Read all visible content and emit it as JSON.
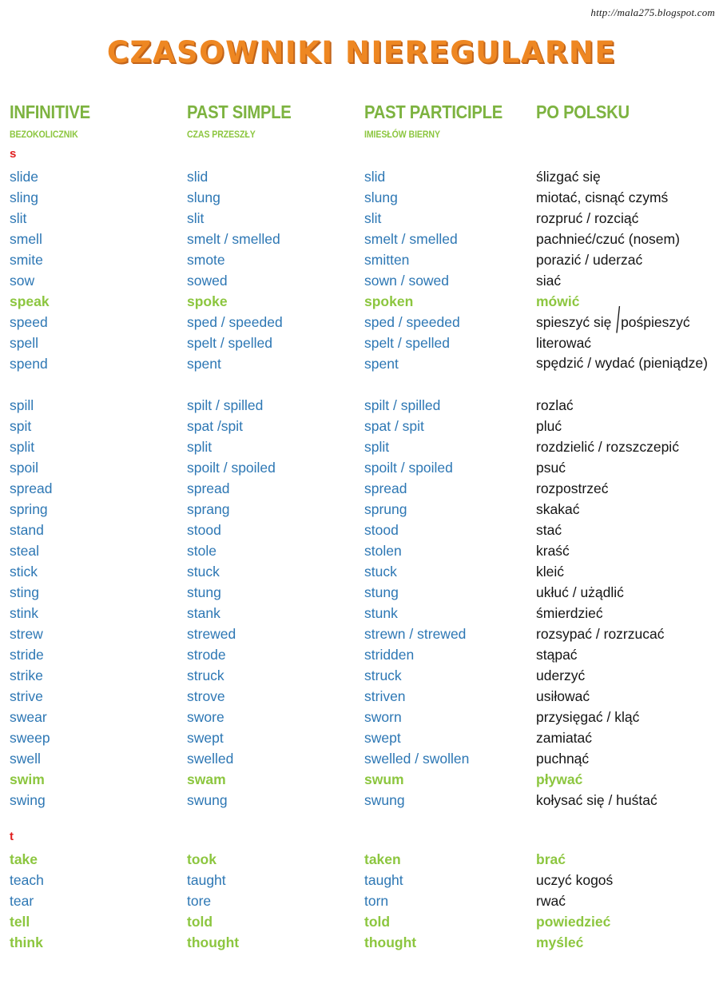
{
  "site_url": "http://mala275.blogspot.com",
  "title": "CZASOWNIKI NIEREGULARNE",
  "colors": {
    "title_orange": "#ee8722",
    "header_green": "#7db340",
    "verb_blue": "#2d77b4",
    "verb_green": "#8cc63f",
    "polish_black": "#141414",
    "section_red": "#e02020"
  },
  "headers": [
    {
      "main": "INFINITIVE",
      "sub": "BEZOKOLICZNIK"
    },
    {
      "main": "PAST SIMPLE",
      "sub": "CZAS PRZESZŁY"
    },
    {
      "main": "PAST PARTICIPLE",
      "sub": "IMIESŁÓW BIERNY"
    },
    {
      "main": "PO POLSKU",
      "sub": ""
    }
  ],
  "sections": [
    {
      "letter": "s",
      "rows": [
        {
          "infinitive": "slide",
          "past": "slid",
          "participle": "slid",
          "polish": "ślizgać się",
          "hl": false
        },
        {
          "infinitive": "sling",
          "past": "slung",
          "participle": "slung",
          "polish": "miotać, cisnąć czymś",
          "hl": false
        },
        {
          "infinitive": "slit",
          "past": "slit",
          "participle": "slit",
          "polish": "rozpruć / rozciąć",
          "hl": false
        },
        {
          "infinitive": "smell",
          "past": "smelt / smelled",
          "participle": "smelt / smelled",
          "polish": "pachnieć/czuć (nosem)",
          "hl": false
        },
        {
          "infinitive": "smite",
          "past": "smote",
          "participle": "smitten",
          "polish": "porazić / uderzać",
          "hl": false
        },
        {
          "infinitive": "sow",
          "past": "sowed",
          "participle": "sown / sowed",
          "polish": "siać",
          "hl": false
        },
        {
          "infinitive": "speak",
          "past": "spoke",
          "participle": "spoken",
          "polish": "mówić",
          "hl": true
        },
        {
          "infinitive": "speed",
          "past": "sped / speeded",
          "participle": "sped / speeded",
          "polish": "spieszyć się / pośpieszyć",
          "hl": false,
          "bigslash": true
        },
        {
          "infinitive": "spell",
          "past": "spelt / spelled",
          "participle": "spelt / spelled",
          "polish": "literować",
          "hl": false
        },
        {
          "infinitive": "spend",
          "past": "spent",
          "participle": "spent",
          "polish": "spędzić / wydać (pieniądze)",
          "hl": false,
          "tall": true
        },
        {
          "infinitive": "spill",
          "past": "spilt /  spilled",
          "participle": "spilt / spilled",
          "polish": "rozlać",
          "hl": false
        },
        {
          "infinitive": "spit",
          "past": "spat /spit",
          "participle": "spat / spit",
          "polish": "pluć",
          "hl": false
        },
        {
          "infinitive": "split",
          "past": "split",
          "participle": "split",
          "polish": "rozdzielić / rozszczepić",
          "hl": false
        },
        {
          "infinitive": "spoil",
          "past": "spoilt / spoiled",
          "participle": "spoilt / spoiled",
          "polish": "psuć",
          "hl": false
        },
        {
          "infinitive": "spread",
          "past": "spread",
          "participle": "spread",
          "polish": "rozpostrzeć",
          "hl": false
        },
        {
          "infinitive": "spring",
          "past": "sprang",
          "participle": "sprung",
          "polish": "skakać",
          "hl": false
        },
        {
          "infinitive": "stand",
          "past": "stood",
          "participle": "stood",
          "polish": "stać",
          "hl": false
        },
        {
          "infinitive": "steal",
          "past": "stole",
          "participle": "stolen",
          "polish": "kraść",
          "hl": false
        },
        {
          "infinitive": "stick",
          "past": "stuck",
          "participle": "stuck",
          "polish": "kleić",
          "hl": false
        },
        {
          "infinitive": "sting",
          "past": "stung",
          "participle": "stung",
          "polish": "ukłuć / użądlić",
          "hl": false
        },
        {
          "infinitive": "stink",
          "past": "stank",
          "participle": "stunk",
          "polish": "śmierdzieć",
          "hl": false
        },
        {
          "infinitive": "strew",
          "past": "strewed",
          "participle": "strewn / strewed",
          "polish": "rozsypać / rozrzucać",
          "hl": false
        },
        {
          "infinitive": "stride",
          "past": "strode",
          "participle": "stridden",
          "polish": "stąpać",
          "hl": false
        },
        {
          "infinitive": "strike",
          "past": "struck",
          "participle": "struck",
          "polish": "uderzyć",
          "hl": false
        },
        {
          "infinitive": "strive",
          "past": "strove",
          "participle": "striven",
          "polish": "usiłować",
          "hl": false
        },
        {
          "infinitive": "swear",
          "past": "swore",
          "participle": "sworn",
          "polish": "przysięgać / kląć",
          "hl": false
        },
        {
          "infinitive": "sweep",
          "past": "swept",
          "participle": "swept",
          "polish": "zamiatać",
          "hl": false
        },
        {
          "infinitive": "swell",
          "past": "swelled",
          "participle": "swelled / swollen",
          "polish": "puchnąć",
          "hl": false
        },
        {
          "infinitive": "swim",
          "past": "swam",
          "participle": "swum",
          "polish": "pływać",
          "hl": true
        },
        {
          "infinitive": "swing",
          "past": "swung",
          "participle": "swung",
          "polish": "kołysać się / huśtać",
          "hl": false
        }
      ]
    },
    {
      "letter": "t",
      "rows": [
        {
          "infinitive": "take",
          "past": "took",
          "participle": "taken",
          "polish": "brać",
          "hl": true
        },
        {
          "infinitive": "teach",
          "past": "taught",
          "participle": "taught",
          "polish": "uczyć kogoś",
          "hl": false
        },
        {
          "infinitive": "tear",
          "past": "tore",
          "participle": "torn",
          "polish": "rwać",
          "hl": false
        },
        {
          "infinitive": "tell",
          "past": "told",
          "participle": "told",
          "polish": "powiedzieć",
          "hl": true
        },
        {
          "infinitive": "think",
          "past": "thought",
          "participle": "thought",
          "polish": "myśleć",
          "hl": true
        }
      ]
    }
  ]
}
